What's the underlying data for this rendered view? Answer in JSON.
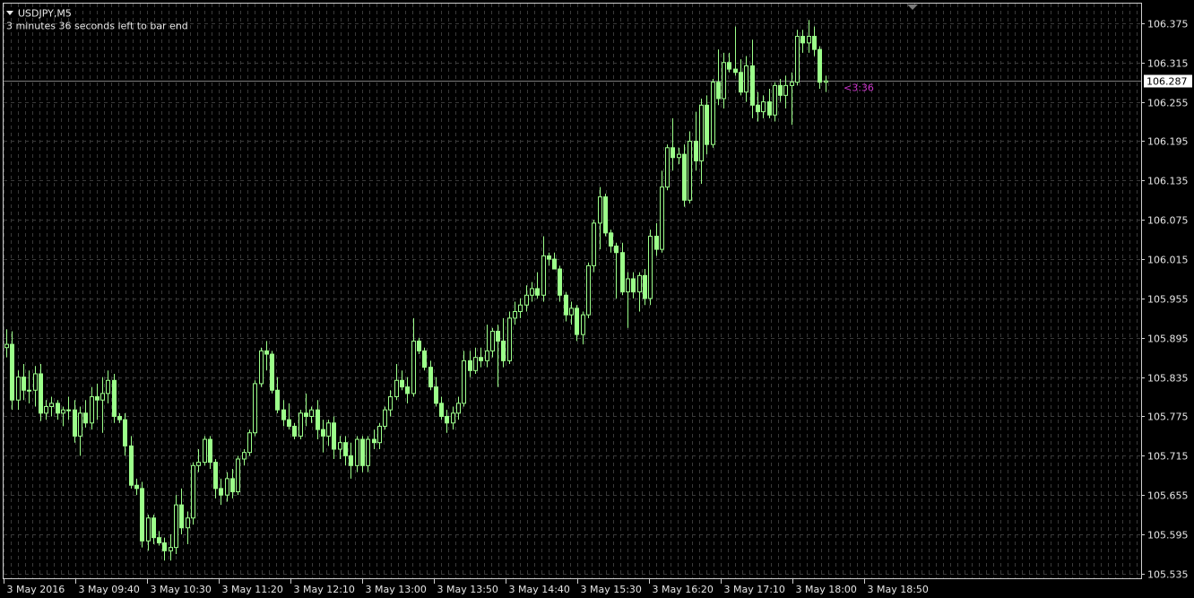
{
  "window": {
    "symbol_title": "USDJPY,M5",
    "countdown_text": "3 minutes 36 seconds left to bar end",
    "bid_line_label": "106.287",
    "timer_label": "<3:36"
  },
  "colors": {
    "background": "#000000",
    "grid": "#3a3a3a",
    "candle": "#9cff8a",
    "text": "#e6e6e6",
    "timer": "#cc33cc",
    "bid_line": "#7a7a7a",
    "frame": "#cfcfcf"
  },
  "icons": {
    "menu_arrow": "triangle-down-icon",
    "shift_marker": "triangle-down-icon"
  },
  "chart_data": {
    "type": "candlestick",
    "symbol": "USDJPY",
    "timeframe": "M5",
    "y_ticks": [
      "106.375",
      "106.315",
      "106.255",
      "106.195",
      "106.135",
      "106.075",
      "106.015",
      "105.955",
      "105.895",
      "105.835",
      "105.775",
      "105.715",
      "105.655",
      "105.595",
      "105.535"
    ],
    "x_tick_labels": [
      "3 May 2016",
      "3 May 09:40",
      "3 May 10:30",
      "3 May 11:20",
      "3 May 12:10",
      "3 May 13:00",
      "3 May 13:50",
      "3 May 14:40",
      "3 May 15:30",
      "3 May 16:20",
      "3 May 17:10",
      "3 May 18:00",
      "3 May 18:50"
    ],
    "ylim": [
      105.528,
      106.405
    ],
    "grid": true,
    "bid": 106.287,
    "candles": [
      {
        "o": 105.88,
        "h": 105.908,
        "l": 105.865,
        "c": 105.885
      },
      {
        "o": 105.885,
        "h": 105.905,
        "l": 105.785,
        "c": 105.8
      },
      {
        "o": 105.8,
        "h": 105.845,
        "l": 105.785,
        "c": 105.835
      },
      {
        "o": 105.835,
        "h": 105.855,
        "l": 105.8,
        "c": 105.815
      },
      {
        "o": 105.815,
        "h": 105.845,
        "l": 105.795,
        "c": 105.815
      },
      {
        "o": 105.815,
        "h": 105.852,
        "l": 105.79,
        "c": 105.84
      },
      {
        "o": 105.84,
        "h": 105.855,
        "l": 105.768,
        "c": 105.78
      },
      {
        "o": 105.78,
        "h": 105.8,
        "l": 105.77,
        "c": 105.79
      },
      {
        "o": 105.79,
        "h": 105.805,
        "l": 105.775,
        "c": 105.795
      },
      {
        "o": 105.795,
        "h": 105.8,
        "l": 105.77,
        "c": 105.78
      },
      {
        "o": 105.78,
        "h": 105.79,
        "l": 105.76,
        "c": 105.785
      },
      {
        "o": 105.785,
        "h": 105.805,
        "l": 105.77,
        "c": 105.785
      },
      {
        "o": 105.785,
        "h": 105.8,
        "l": 105.735,
        "c": 105.745
      },
      {
        "o": 105.745,
        "h": 105.79,
        "l": 105.715,
        "c": 105.78
      },
      {
        "o": 105.78,
        "h": 105.8,
        "l": 105.758,
        "c": 105.765
      },
      {
        "o": 105.765,
        "h": 105.82,
        "l": 105.755,
        "c": 105.805
      },
      {
        "o": 105.805,
        "h": 105.825,
        "l": 105.77,
        "c": 105.8
      },
      {
        "o": 105.8,
        "h": 105.835,
        "l": 105.75,
        "c": 105.81
      },
      {
        "o": 105.81,
        "h": 105.845,
        "l": 105.795,
        "c": 105.83
      },
      {
        "o": 105.83,
        "h": 105.84,
        "l": 105.765,
        "c": 105.775
      },
      {
        "o": 105.775,
        "h": 105.78,
        "l": 105.765,
        "c": 105.77
      },
      {
        "o": 105.77,
        "h": 105.78,
        "l": 105.715,
        "c": 105.73
      },
      {
        "o": 105.73,
        "h": 105.745,
        "l": 105.665,
        "c": 105.67
      },
      {
        "o": 105.67,
        "h": 105.68,
        "l": 105.655,
        "c": 105.665
      },
      {
        "o": 105.665,
        "h": 105.675,
        "l": 105.575,
        "c": 105.585
      },
      {
        "o": 105.585,
        "h": 105.625,
        "l": 105.57,
        "c": 105.62
      },
      {
        "o": 105.62,
        "h": 105.625,
        "l": 105.58,
        "c": 105.59
      },
      {
        "o": 105.59,
        "h": 105.6,
        "l": 105.578,
        "c": 105.582
      },
      {
        "o": 105.582,
        "h": 105.59,
        "l": 105.555,
        "c": 105.57
      },
      {
        "o": 105.57,
        "h": 105.595,
        "l": 105.555,
        "c": 105.575
      },
      {
        "o": 105.575,
        "h": 105.655,
        "l": 105.565,
        "c": 105.64
      },
      {
        "o": 105.64,
        "h": 105.665,
        "l": 105.595,
        "c": 105.605
      },
      {
        "o": 105.605,
        "h": 105.63,
        "l": 105.58,
        "c": 105.62
      },
      {
        "o": 105.62,
        "h": 105.705,
        "l": 105.61,
        "c": 105.7
      },
      {
        "o": 105.7,
        "h": 105.725,
        "l": 105.69,
        "c": 105.705
      },
      {
        "o": 105.705,
        "h": 105.745,
        "l": 105.7,
        "c": 105.74
      },
      {
        "o": 105.74,
        "h": 105.745,
        "l": 105.695,
        "c": 105.705
      },
      {
        "o": 105.705,
        "h": 105.71,
        "l": 105.65,
        "c": 105.665
      },
      {
        "o": 105.665,
        "h": 105.68,
        "l": 105.64,
        "c": 105.655
      },
      {
        "o": 105.655,
        "h": 105.69,
        "l": 105.645,
        "c": 105.68
      },
      {
        "o": 105.68,
        "h": 105.695,
        "l": 105.65,
        "c": 105.66
      },
      {
        "o": 105.66,
        "h": 105.715,
        "l": 105.655,
        "c": 105.71
      },
      {
        "o": 105.71,
        "h": 105.725,
        "l": 105.7,
        "c": 105.72
      },
      {
        "o": 105.72,
        "h": 105.755,
        "l": 105.715,
        "c": 105.75
      },
      {
        "o": 105.75,
        "h": 105.83,
        "l": 105.745,
        "c": 105.825
      },
      {
        "o": 105.825,
        "h": 105.88,
        "l": 105.82,
        "c": 105.875
      },
      {
        "o": 105.875,
        "h": 105.89,
        "l": 105.845,
        "c": 105.87
      },
      {
        "o": 105.87,
        "h": 105.875,
        "l": 105.81,
        "c": 105.815
      },
      {
        "o": 105.815,
        "h": 105.835,
        "l": 105.78,
        "c": 105.785
      },
      {
        "o": 105.785,
        "h": 105.8,
        "l": 105.76,
        "c": 105.77
      },
      {
        "o": 105.77,
        "h": 105.795,
        "l": 105.755,
        "c": 105.76
      },
      {
        "o": 105.76,
        "h": 105.765,
        "l": 105.74,
        "c": 105.745
      },
      {
        "o": 105.745,
        "h": 105.785,
        "l": 105.74,
        "c": 105.78
      },
      {
        "o": 105.78,
        "h": 105.81,
        "l": 105.76,
        "c": 105.775
      },
      {
        "o": 105.775,
        "h": 105.79,
        "l": 105.765,
        "c": 105.785
      },
      {
        "o": 105.785,
        "h": 105.8,
        "l": 105.74,
        "c": 105.755
      },
      {
        "o": 105.755,
        "h": 105.77,
        "l": 105.72,
        "c": 105.745
      },
      {
        "o": 105.745,
        "h": 105.77,
        "l": 105.73,
        "c": 105.765
      },
      {
        "o": 105.765,
        "h": 105.775,
        "l": 105.71,
        "c": 105.725
      },
      {
        "o": 105.725,
        "h": 105.745,
        "l": 105.71,
        "c": 105.735
      },
      {
        "o": 105.735,
        "h": 105.745,
        "l": 105.7,
        "c": 105.715
      },
      {
        "o": 105.715,
        "h": 105.735,
        "l": 105.68,
        "c": 105.7
      },
      {
        "o": 105.7,
        "h": 105.745,
        "l": 105.69,
        "c": 105.74
      },
      {
        "o": 105.74,
        "h": 105.745,
        "l": 105.69,
        "c": 105.7
      },
      {
        "o": 105.7,
        "h": 105.745,
        "l": 105.69,
        "c": 105.74
      },
      {
        "o": 105.74,
        "h": 105.755,
        "l": 105.725,
        "c": 105.735
      },
      {
        "o": 105.735,
        "h": 105.765,
        "l": 105.725,
        "c": 105.76
      },
      {
        "o": 105.76,
        "h": 105.79,
        "l": 105.755,
        "c": 105.785
      },
      {
        "o": 105.785,
        "h": 105.815,
        "l": 105.775,
        "c": 105.805
      },
      {
        "o": 105.805,
        "h": 105.855,
        "l": 105.8,
        "c": 105.83
      },
      {
        "o": 105.83,
        "h": 105.845,
        "l": 105.815,
        "c": 105.82
      },
      {
        "o": 105.82,
        "h": 105.835,
        "l": 105.795,
        "c": 105.81
      },
      {
        "o": 105.81,
        "h": 105.925,
        "l": 105.805,
        "c": 105.89
      },
      {
        "o": 105.89,
        "h": 105.895,
        "l": 105.87,
        "c": 105.875
      },
      {
        "o": 105.875,
        "h": 105.88,
        "l": 105.845,
        "c": 105.85
      },
      {
        "o": 105.85,
        "h": 105.86,
        "l": 105.815,
        "c": 105.82
      },
      {
        "o": 105.82,
        "h": 105.835,
        "l": 105.79,
        "c": 105.795
      },
      {
        "o": 105.795,
        "h": 105.805,
        "l": 105.77,
        "c": 105.775
      },
      {
        "o": 105.775,
        "h": 105.785,
        "l": 105.75,
        "c": 105.765
      },
      {
        "o": 105.765,
        "h": 105.79,
        "l": 105.755,
        "c": 105.78
      },
      {
        "o": 105.78,
        "h": 105.805,
        "l": 105.77,
        "c": 105.795
      },
      {
        "o": 105.795,
        "h": 105.875,
        "l": 105.79,
        "c": 105.86
      },
      {
        "o": 105.86,
        "h": 105.875,
        "l": 105.835,
        "c": 105.845
      },
      {
        "o": 105.845,
        "h": 105.88,
        "l": 105.84,
        "c": 105.865
      },
      {
        "o": 105.865,
        "h": 105.88,
        "l": 105.85,
        "c": 105.86
      },
      {
        "o": 105.86,
        "h": 105.915,
        "l": 105.85,
        "c": 105.875
      },
      {
        "o": 105.875,
        "h": 105.91,
        "l": 105.865,
        "c": 105.905
      },
      {
        "o": 105.905,
        "h": 105.915,
        "l": 105.82,
        "c": 105.89
      },
      {
        "o": 105.89,
        "h": 105.925,
        "l": 105.85,
        "c": 105.86
      },
      {
        "o": 105.86,
        "h": 105.935,
        "l": 105.855,
        "c": 105.925
      },
      {
        "o": 105.925,
        "h": 105.95,
        "l": 105.915,
        "c": 105.935
      },
      {
        "o": 105.935,
        "h": 105.955,
        "l": 105.925,
        "c": 105.945
      },
      {
        "o": 105.945,
        "h": 105.975,
        "l": 105.935,
        "c": 105.96
      },
      {
        "o": 105.96,
        "h": 105.98,
        "l": 105.95,
        "c": 105.97
      },
      {
        "o": 105.97,
        "h": 105.995,
        "l": 105.955,
        "c": 105.96
      },
      {
        "o": 105.96,
        "h": 106.05,
        "l": 105.95,
        "c": 106.02
      },
      {
        "o": 106.02,
        "h": 106.025,
        "l": 106.005,
        "c": 106.015
      },
      {
        "o": 106.015,
        "h": 106.025,
        "l": 106.0,
        "c": 106.0
      },
      {
        "o": 106.0,
        "h": 106.005,
        "l": 105.95,
        "c": 105.96
      },
      {
        "o": 105.96,
        "h": 105.965,
        "l": 105.92,
        "c": 105.93
      },
      {
        "o": 105.93,
        "h": 105.95,
        "l": 105.915,
        "c": 105.94
      },
      {
        "o": 105.94,
        "h": 105.945,
        "l": 105.89,
        "c": 105.9
      },
      {
        "o": 105.9,
        "h": 105.935,
        "l": 105.885,
        "c": 105.93
      },
      {
        "o": 105.93,
        "h": 106.01,
        "l": 105.925,
        "c": 106.005
      },
      {
        "o": 106.005,
        "h": 106.075,
        "l": 105.995,
        "c": 106.07
      },
      {
        "o": 106.07,
        "h": 106.125,
        "l": 106.03,
        "c": 106.11
      },
      {
        "o": 106.11,
        "h": 106.115,
        "l": 106.05,
        "c": 106.055
      },
      {
        "o": 106.055,
        "h": 106.06,
        "l": 106.025,
        "c": 106.035
      },
      {
        "o": 106.035,
        "h": 106.04,
        "l": 105.955,
        "c": 106.025
      },
      {
        "o": 106.025,
        "h": 106.04,
        "l": 105.96,
        "c": 105.965
      },
      {
        "o": 105.965,
        "h": 105.995,
        "l": 105.91,
        "c": 105.985
      },
      {
        "o": 105.985,
        "h": 105.995,
        "l": 105.955,
        "c": 105.965
      },
      {
        "o": 105.965,
        "h": 105.995,
        "l": 105.935,
        "c": 105.99
      },
      {
        "o": 105.99,
        "h": 106.0,
        "l": 105.945,
        "c": 105.955
      },
      {
        "o": 105.955,
        "h": 106.06,
        "l": 105.945,
        "c": 106.05
      },
      {
        "o": 106.05,
        "h": 106.07,
        "l": 106.02,
        "c": 106.03
      },
      {
        "o": 106.03,
        "h": 106.15,
        "l": 106.025,
        "c": 106.125
      },
      {
        "o": 106.125,
        "h": 106.19,
        "l": 106.12,
        "c": 106.185
      },
      {
        "o": 106.185,
        "h": 106.23,
        "l": 106.15,
        "c": 106.17
      },
      {
        "o": 106.17,
        "h": 106.185,
        "l": 106.16,
        "c": 106.175
      },
      {
        "o": 106.175,
        "h": 106.19,
        "l": 106.095,
        "c": 106.105
      },
      {
        "o": 106.105,
        "h": 106.21,
        "l": 106.1,
        "c": 106.195
      },
      {
        "o": 106.195,
        "h": 106.24,
        "l": 106.15,
        "c": 106.165
      },
      {
        "o": 106.165,
        "h": 106.26,
        "l": 106.13,
        "c": 106.25
      },
      {
        "o": 106.25,
        "h": 106.265,
        "l": 106.175,
        "c": 106.19
      },
      {
        "o": 106.19,
        "h": 106.29,
        "l": 106.185,
        "c": 106.285
      },
      {
        "o": 106.285,
        "h": 106.335,
        "l": 106.25,
        "c": 106.26
      },
      {
        "o": 106.26,
        "h": 106.33,
        "l": 106.245,
        "c": 106.315
      },
      {
        "o": 106.315,
        "h": 106.33,
        "l": 106.3,
        "c": 106.305
      },
      {
        "o": 106.305,
        "h": 106.37,
        "l": 106.295,
        "c": 106.3
      },
      {
        "o": 106.3,
        "h": 106.32,
        "l": 106.265,
        "c": 106.27
      },
      {
        "o": 106.27,
        "h": 106.325,
        "l": 106.255,
        "c": 106.31
      },
      {
        "o": 106.31,
        "h": 106.35,
        "l": 106.23,
        "c": 106.25
      },
      {
        "o": 106.25,
        "h": 106.27,
        "l": 106.225,
        "c": 106.24
      },
      {
        "o": 106.24,
        "h": 106.265,
        "l": 106.23,
        "c": 106.255
      },
      {
        "o": 106.255,
        "h": 106.275,
        "l": 106.23,
        "c": 106.235
      },
      {
        "o": 106.235,
        "h": 106.285,
        "l": 106.225,
        "c": 106.28
      },
      {
        "o": 106.28,
        "h": 106.29,
        "l": 106.255,
        "c": 106.265
      },
      {
        "o": 106.265,
        "h": 106.295,
        "l": 106.245,
        "c": 106.28
      },
      {
        "o": 106.28,
        "h": 106.3,
        "l": 106.22,
        "c": 106.285
      },
      {
        "o": 106.285,
        "h": 106.365,
        "l": 106.28,
        "c": 106.355
      },
      {
        "o": 106.355,
        "h": 106.365,
        "l": 106.33,
        "c": 106.345
      },
      {
        "o": 106.345,
        "h": 106.38,
        "l": 106.33,
        "c": 106.355
      },
      {
        "o": 106.355,
        "h": 106.37,
        "l": 106.325,
        "c": 106.335
      },
      {
        "o": 106.335,
        "h": 106.34,
        "l": 106.275,
        "c": 106.285
      },
      {
        "o": 106.285,
        "h": 106.295,
        "l": 106.27,
        "c": 106.287
      }
    ]
  }
}
